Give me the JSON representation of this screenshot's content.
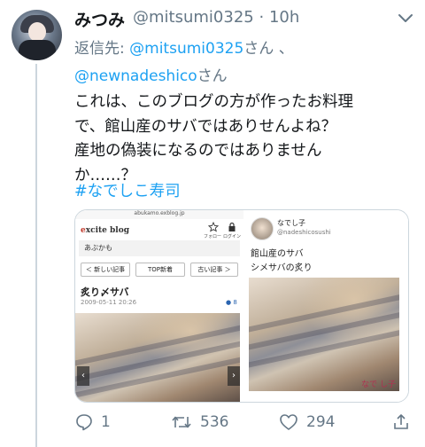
{
  "tweet": {
    "display_name": "みつみ",
    "handle": "@mitsumi0325",
    "separator": "·",
    "time": "10h",
    "reply_prefix": "返信先: ",
    "reply_mentions": [
      "@mitsumi0325",
      "@newnadeshico"
    ],
    "reply_san": "さん",
    "reply_join": "、",
    "text_lines": [
      "これは、このブログの方が作ったお料理",
      "で、館山産のサバではありせんよね？",
      "産地の偽装になるのではありません",
      "か……？"
    ],
    "hashtag": "#なでしこ寿司"
  },
  "media": {
    "left": {
      "url": "abukamo.exblog.jp",
      "logo_e": "e",
      "logo_rest": "xcite blog",
      "follow_label": "フォロー",
      "login_label": "ログイン",
      "blog_name": "あぶかも",
      "nav": [
        "＜ 新しい記事",
        "TOP新着",
        "古い記事 ＞"
      ],
      "post_title": "炙り〆サバ",
      "post_date": "2009-05-11 20:26",
      "comment_count": "8"
    },
    "right": {
      "account_name": "なでし子",
      "account_handle": "@nadeshicosushi",
      "line1": "館山産のサバ",
      "line2": "シメサバの炙り",
      "watermark": "なで し子"
    }
  },
  "actions": {
    "reply_count": "1",
    "retweet_count": "536",
    "like_count": "294"
  }
}
